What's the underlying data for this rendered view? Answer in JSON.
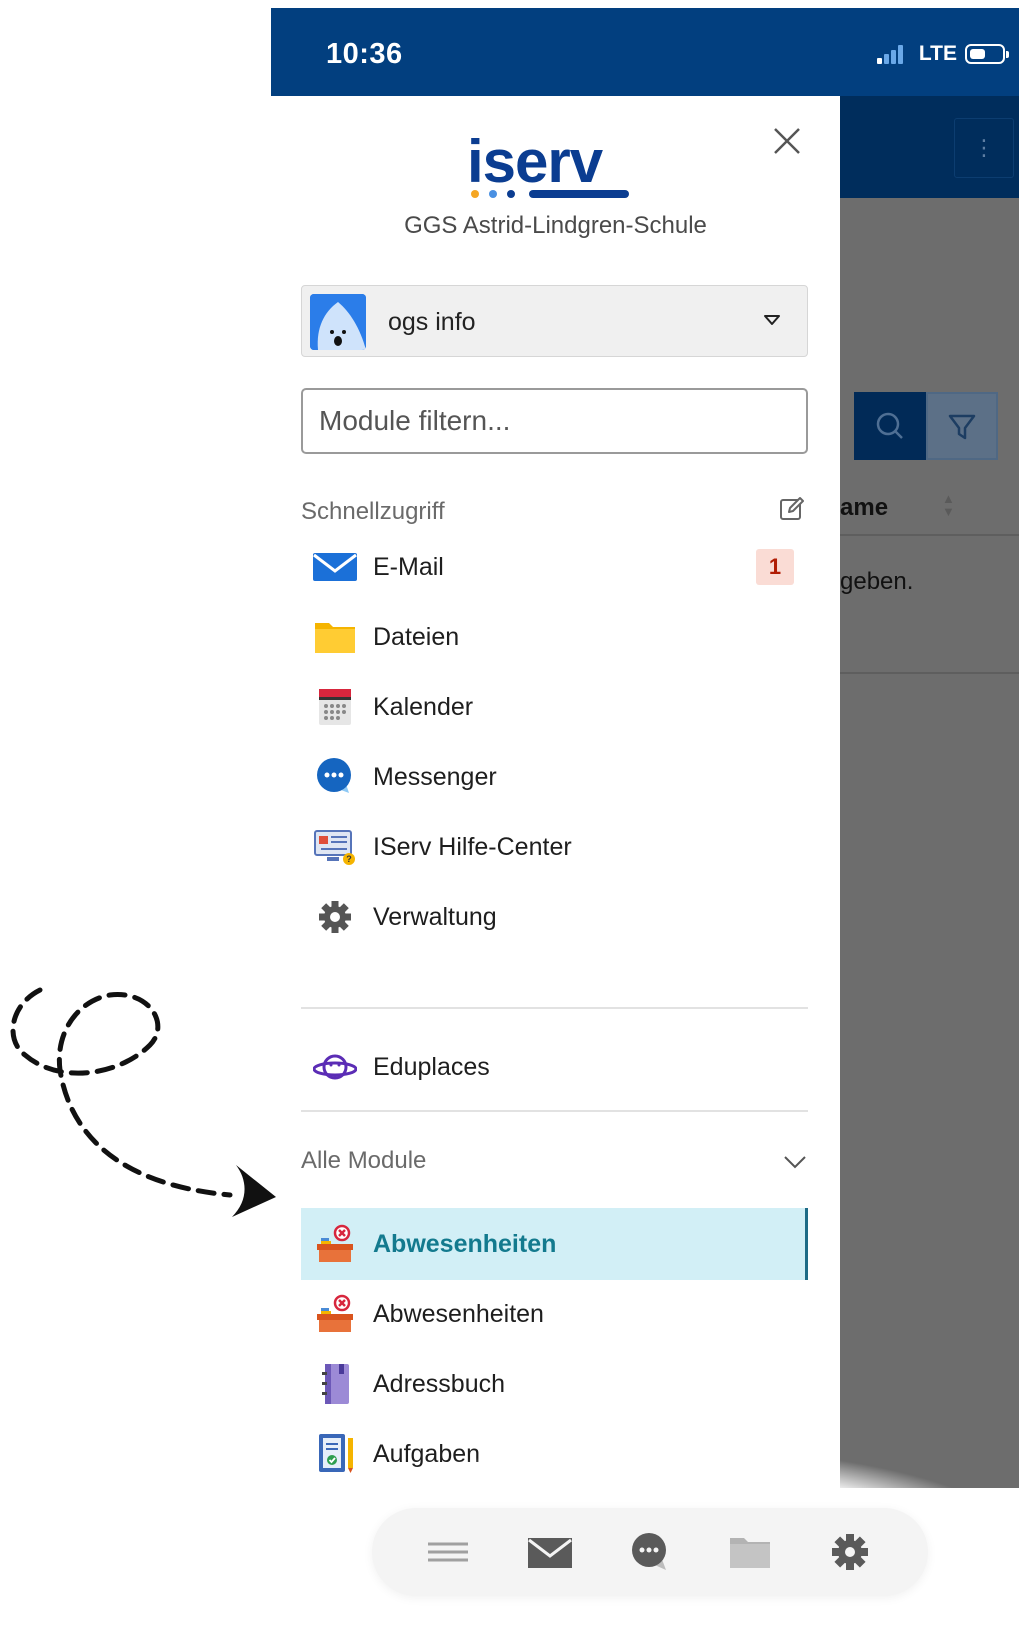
{
  "status_bar": {
    "time": "10:36",
    "network": "LTE"
  },
  "background_app": {
    "column_header": "ame",
    "empty_text": "geben."
  },
  "drawer": {
    "logo_text": "iserv",
    "school_name": "GGS Astrid-Lindgren-Schule",
    "user": {
      "name": "ogs info"
    },
    "filter": {
      "placeholder": "Module filtern..."
    },
    "quick_access": {
      "title": "Schnellzugriff",
      "items": [
        {
          "label": "E-Mail",
          "icon": "mail-icon",
          "badge": "1"
        },
        {
          "label": "Dateien",
          "icon": "folder-icon"
        },
        {
          "label": "Kalender",
          "icon": "calendar-icon"
        },
        {
          "label": "Messenger",
          "icon": "chat-icon"
        },
        {
          "label": "IServ Hilfe-Center",
          "icon": "help-center-icon"
        },
        {
          "label": "Verwaltung",
          "icon": "gear-icon"
        }
      ]
    },
    "eduplaces": {
      "label": "Eduplaces",
      "icon": "planet-icon"
    },
    "all_modules": {
      "title": "Alle Module",
      "items": [
        {
          "label": "Abwesenheiten",
          "icon": "absence-icon",
          "active": true
        },
        {
          "label": "Abwesenheiten",
          "icon": "absence-icon"
        },
        {
          "label": "Adressbuch",
          "icon": "addressbook-icon"
        },
        {
          "label": "Aufgaben",
          "icon": "tasks-icon"
        }
      ]
    }
  },
  "bottom_nav": [
    "menu-icon",
    "mail-icon",
    "chat-icon",
    "folder-icon",
    "gear-icon"
  ],
  "colors": {
    "status_bar": "#023f7f",
    "accent": "#137a8e",
    "active_bg": "#d2eff6",
    "badge_bg": "#fadcd5",
    "badge_text": "#b11d05",
    "logo_blue": "#0b3d91"
  }
}
